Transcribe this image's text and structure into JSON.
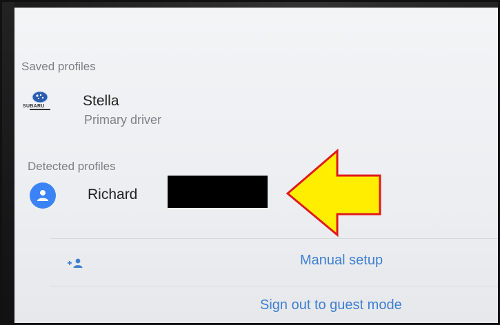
{
  "saved_profiles": {
    "heading": "Saved profiles",
    "items": [
      {
        "name": "Stella",
        "subtitle": "Primary driver",
        "logo_text": "SUBARU"
      }
    ]
  },
  "detected_profiles": {
    "heading": "Detected profiles",
    "items": [
      {
        "name": "Richard",
        "redacted": true
      }
    ]
  },
  "actions": {
    "manual_setup": "Manual setup",
    "guest_mode": "Sign out to guest mode"
  },
  "colors": {
    "accent": "#3f7fd0",
    "avatar": "#3b82f6",
    "annotation_arrow": "#ffee00",
    "annotation_outline": "#e0191f"
  },
  "icons": {
    "avatar": "person-icon",
    "manual_setup": "add-person-icon",
    "annotation": "arrow-left-icon"
  }
}
